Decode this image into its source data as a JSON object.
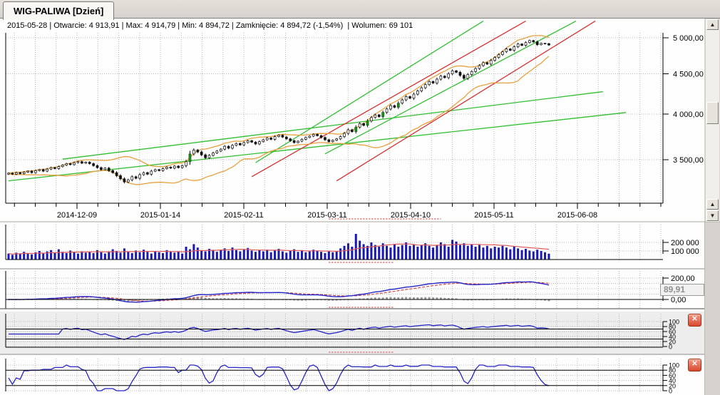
{
  "window": {
    "tab_label": "WIG-PALIWA [Dzień]"
  },
  "info_bar": {
    "text": "2015-05-28 | Otwarcie: 4 913,91 | Max: 4 914,79 | Min: 4 894,72 | Zamknięcie: 4 894,72 (-1,54%)  | Wolumen: 69 101"
  },
  "ui": {
    "close_glyph": "✕",
    "scroll_up_glyph": "▲",
    "scroll_down_glyph": "▼"
  },
  "colors": {
    "bollinger": "#e8a13f",
    "trend_green": "#2fbf2f",
    "trend_red": "#d93030",
    "volume_bar": "#1a1ab2",
    "volume_ma": "#e05858",
    "macd_line": "#2424c8",
    "macd_signal": "#d23b3b",
    "macd_hist": "#9a9a9a",
    "oscillator": "#2424c8",
    "highlight": "#e06666",
    "grid": "#b5b5b5",
    "panel3_bg": "#ededed"
  },
  "chart_data": {
    "type": "candlestick",
    "title": "WIG-PALIWA [Dzień]",
    "x_axis": {
      "tick_labels": [
        "2014-12-09",
        "2015-01-14",
        "2015-02-11",
        "2015-03-11",
        "2015-04-10",
        "2015-05-11",
        "2015-06-08"
      ]
    },
    "y_axis": {
      "scale": "log",
      "tick_labels": [
        "5 000,00",
        "4 500,00",
        "4 000,00",
        "3 500,00"
      ],
      "tick_values": [
        5000,
        4500,
        4000,
        3500
      ]
    },
    "candles": {
      "closes": [
        3365,
        3355,
        3370,
        3360,
        3375,
        3385,
        3370,
        3390,
        3400,
        3385,
        3405,
        3420,
        3410,
        3430,
        3445,
        3460,
        3450,
        3470,
        3480,
        3465,
        3475,
        3460,
        3440,
        3420,
        3400,
        3415,
        3390,
        3370,
        3340,
        3310,
        3280,
        3300,
        3330,
        3315,
        3350,
        3370,
        3355,
        3385,
        3400,
        3390,
        3410,
        3425,
        3415,
        3435,
        3420,
        3440,
        3480,
        3560,
        3600,
        3580,
        3550,
        3520,
        3545,
        3570,
        3590,
        3610,
        3640,
        3620,
        3650,
        3670,
        3655,
        3680,
        3700,
        3685,
        3665,
        3690,
        3710,
        3730,
        3715,
        3745,
        3760,
        3740,
        3720,
        3700,
        3680,
        3695,
        3715,
        3735,
        3750,
        3770,
        3755,
        3735,
        3710,
        3690,
        3705,
        3720,
        3745,
        3780,
        3820,
        3800,
        3850,
        3890,
        3870,
        3920,
        3960,
        3990,
        3970,
        4020,
        4060,
        4100,
        4080,
        4130,
        4170,
        4210,
        4190,
        4240,
        4280,
        4320,
        4360,
        4400,
        4380,
        4430,
        4470,
        4450,
        4500,
        4540,
        4520,
        4480,
        4440,
        4490,
        4530,
        4570,
        4610,
        4650,
        4630,
        4680,
        4720,
        4760,
        4800,
        4840,
        4820,
        4870,
        4910,
        4890,
        4930,
        4960,
        4940,
        4900,
        4920,
        4915,
        4895
      ]
    },
    "bollinger": {
      "period": 15,
      "mult": 2
    },
    "trend_lines": [
      {
        "from_i": 14,
        "from_v": 3506,
        "to_i": 154,
        "to_v": 4271,
        "color": "green"
      },
      {
        "from_i": 0,
        "from_v": 3290,
        "to_i": 160,
        "to_v": 4018,
        "color": "green"
      },
      {
        "from_i": 64,
        "from_v": 3470,
        "to_i": 123,
        "to_v": 5250,
        "color": "green"
      },
      {
        "from_i": 82,
        "from_v": 3560,
        "to_i": 147,
        "to_v": 5250,
        "color": "green"
      },
      {
        "from_i": 63,
        "from_v": 3330,
        "to_i": 134,
        "to_v": 5250,
        "color": "red"
      },
      {
        "from_i": 85,
        "from_v": 3290,
        "to_i": 152,
        "to_v": 5250,
        "color": "red"
      }
    ],
    "volume": {
      "axis_labels": [
        "200 000",
        "100 000"
      ],
      "axis_values": [
        200,
        100
      ],
      "ma_period": 15,
      "values_k": [
        70,
        55,
        80,
        65,
        90,
        75,
        60,
        85,
        100,
        70,
        95,
        110,
        80,
        120,
        90,
        75,
        105,
        85,
        70,
        95,
        80,
        90,
        75,
        110,
        85,
        70,
        95,
        120,
        100,
        80,
        130,
        95,
        75,
        105,
        85,
        115,
        90,
        70,
        100,
        85,
        75,
        110,
        90,
        80,
        95,
        70,
        150,
        120,
        180,
        140,
        110,
        95,
        125,
        105,
        90,
        115,
        130,
        100,
        140,
        110,
        95,
        120,
        135,
        105,
        90,
        110,
        95,
        115,
        85,
        105,
        125,
        95,
        80,
        100,
        120,
        90,
        110,
        85,
        95,
        115,
        105,
        90,
        75,
        95,
        85,
        100,
        130,
        160,
        190,
        150,
        300,
        220,
        180,
        160,
        200,
        170,
        150,
        190,
        160,
        140,
        180,
        150,
        170,
        200,
        160,
        180,
        150,
        170,
        190,
        160,
        140,
        170,
        200,
        180,
        150,
        230,
        210,
        170,
        190,
        160,
        180,
        150,
        170,
        140,
        160,
        130,
        150,
        140,
        160,
        140,
        120,
        150,
        130,
        110,
        125,
        105,
        95,
        115,
        100,
        85,
        69
      ]
    },
    "macd": {
      "fast": 12,
      "slow": 26,
      "signal": 9,
      "axis_labels": [
        "200,00",
        "0,00"
      ],
      "axis_values": [
        200,
        0
      ],
      "grid_values": [
        200,
        150,
        100,
        50
      ],
      "last_value_label": "89,91"
    },
    "rsi": {
      "period": 14,
      "levels": [
        70,
        30
      ],
      "axis_labels": [
        "100",
        "80",
        "60",
        "40",
        "20",
        "0"
      ],
      "axis_values": [
        100,
        80,
        60,
        40,
        20,
        0
      ]
    },
    "stochastic": {
      "period": 5,
      "smooth": 3,
      "levels": [
        80,
        20
      ],
      "axis_labels": [
        "100",
        "80",
        "60",
        "40",
        "20",
        "0"
      ],
      "axis_values": [
        100,
        80,
        60,
        40,
        20,
        0
      ]
    },
    "highlights": [
      {
        "panel": "xaxis",
        "from_i": 83,
        "to_i": 112
      },
      {
        "panel": "volume",
        "from_i": 83,
        "to_i": 100
      },
      {
        "panel": "macd",
        "from_i": 83,
        "to_i": 100
      },
      {
        "panel": "rsi",
        "from_i": 83,
        "to_i": 100
      }
    ]
  }
}
